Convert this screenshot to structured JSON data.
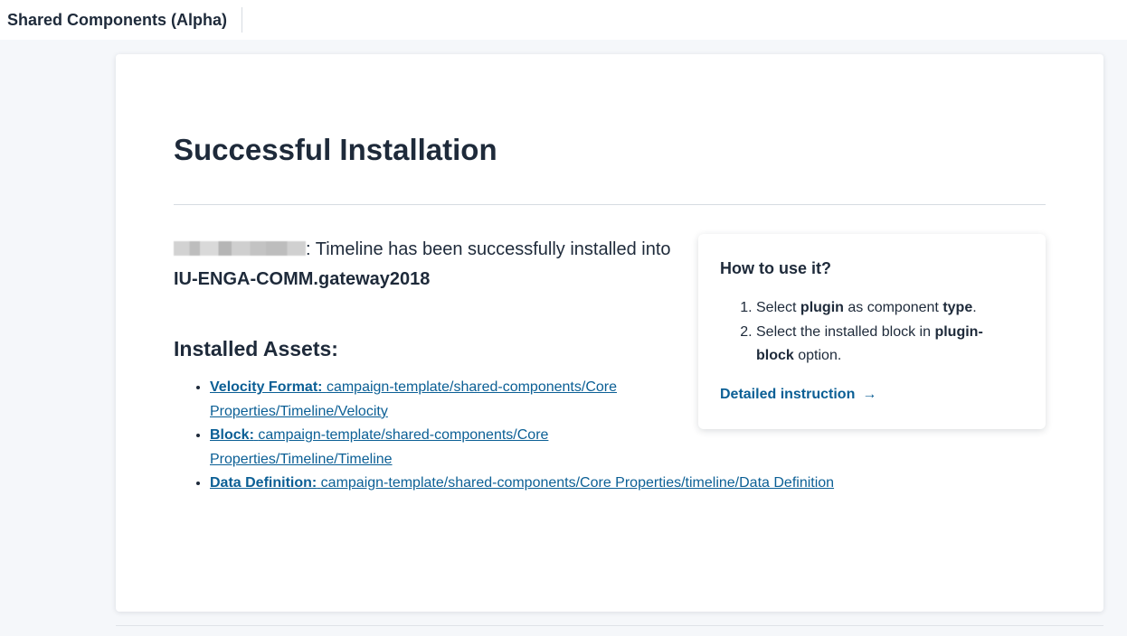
{
  "header": {
    "app_title": "Shared Components (Alpha)"
  },
  "main": {
    "title": "Successful Installation",
    "message": {
      "text_after_name": ": Timeline has been successfully installed into ",
      "target": "IU-ENGA-COMM.gateway2018"
    },
    "assets": {
      "title": "Installed Assets:",
      "items": [
        {
          "label": "Velocity Format:",
          "path": "campaign-template/shared-components/Core Properties/Timeline/Velocity"
        },
        {
          "label": "Block:",
          "path": "campaign-template/shared-components/Core Properties/Timeline/Timeline"
        },
        {
          "label": "Data Definition:",
          "path": "campaign-template/shared-components/Core Properties/timeline/Data Definition"
        }
      ]
    }
  },
  "help": {
    "title": "How to use it?",
    "steps": [
      {
        "a": "Select ",
        "b1": "plugin",
        "c": " as component ",
        "b2": "type",
        "d": "."
      },
      {
        "a": "Select the installed block in ",
        "b1": "plugin-block",
        "c": " option."
      }
    ],
    "link_label": "Detailed instruction",
    "link_icon": "→"
  },
  "colors": {
    "link": "#0b5f95",
    "text": "#1e2a3a",
    "background": "#f5f7fa"
  }
}
